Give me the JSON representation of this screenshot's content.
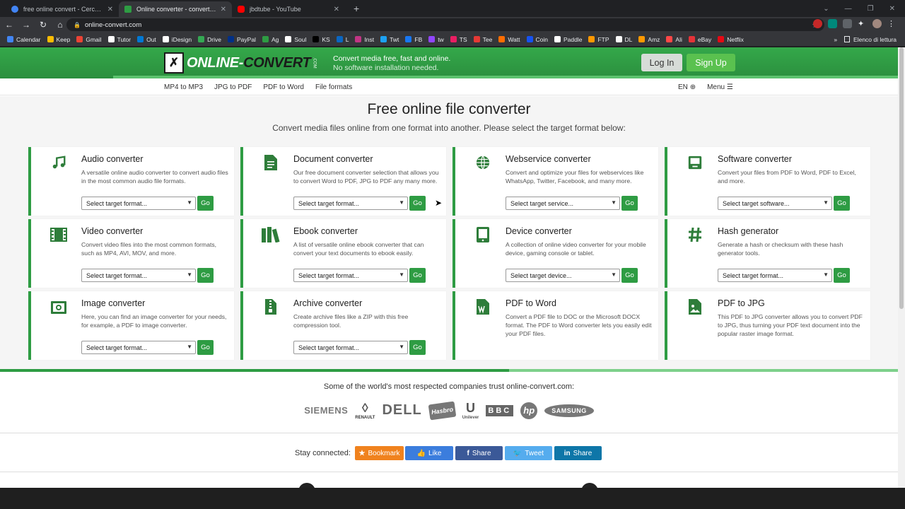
{
  "browser": {
    "tabs": [
      {
        "title": "free online convert - Cerca con G",
        "favicon_color": "#4285f4",
        "active": false
      },
      {
        "title": "Online converter - convert video",
        "favicon_color": "#2e9c43",
        "active": true
      },
      {
        "title": "jbdtube - YouTube",
        "favicon_color": "#ff0000",
        "active": false
      }
    ],
    "new_tab": "+",
    "url": "online-convert.com",
    "bookmarks": [
      "Calendar",
      "Keep",
      "Gmail",
      "Tutor",
      "Out",
      "iDesign",
      "Drive",
      "PayPal",
      "Ag",
      "Soul",
      "KS",
      "L",
      "Inst",
      "Twt",
      "FB",
      "tw",
      "TS",
      "Tee",
      "Watt",
      "Coin",
      "Paddle",
      "FTP",
      "DL",
      "Amz",
      "Ali",
      "eBay",
      "Netflix"
    ],
    "bookmark_colors": [
      "#4285f4",
      "#fbbc04",
      "#ea4335",
      "#ffffff",
      "#0078d4",
      "#ffffff",
      "#34a853",
      "#003087",
      "#2e9c43",
      "#ffffff",
      "#000000",
      "#0a66c2",
      "#c13584",
      "#1da1f2",
      "#1877f2",
      "#9146ff",
      "#e91e63",
      "#e53935",
      "#ff6d00",
      "#1652f0",
      "#ffffff",
      "#ff9800",
      "#fafafa",
      "#ff9900",
      "#ff4747",
      "#e53238",
      "#e50914"
    ],
    "more_bookmarks": "»",
    "reading_list": "Elenco di lettura"
  },
  "header": {
    "logo_text_white": "ONLINE-",
    "logo_text_dark": "CONVERT",
    "logo_com": ".COM",
    "tagline": "Convert media free, fast and online.",
    "tagline_sub": "No software installation needed.",
    "login": "Log In",
    "signup": "Sign Up"
  },
  "subnav": {
    "links": [
      "MP4 to MP3",
      "JPG to PDF",
      "PDF to Word",
      "File formats"
    ],
    "lang": "EN",
    "menu": "Menu"
  },
  "main": {
    "title": "Free online file converter",
    "subtitle": "Convert media files online from one format into another. Please select the target format below:",
    "go": "Go",
    "cards": [
      {
        "title": "Audio converter",
        "desc": "A versatile online audio converter to convert audio files in the most common audio file formats.",
        "select": "Select target format...",
        "icon": "music-note-icon"
      },
      {
        "title": "Document converter",
        "desc": "Our free document converter selection that allows you to convert Word to PDF, JPG to PDF any many more.",
        "select": "Select target format...",
        "icon": "document-icon"
      },
      {
        "title": "Webservice converter",
        "desc": "Convert and optimize your files for webservices like WhatsApp, Twitter, Facebook, and many more.",
        "select": "Select target service...",
        "icon": "globe-icon"
      },
      {
        "title": "Software converter",
        "desc": "Convert your files from PDF to Word, PDF to Excel, and more.",
        "select": "Select target software...",
        "icon": "monitor-icon"
      },
      {
        "title": "Video converter",
        "desc": "Convert video files into the most common formats, such as MP4, AVI, MOV, and more.",
        "select": "Select target format...",
        "icon": "film-icon"
      },
      {
        "title": "Ebook converter",
        "desc": "A list of versatile online ebook converter that can convert your text documents to ebook easily.",
        "select": "Select target format...",
        "icon": "books-icon"
      },
      {
        "title": "Device converter",
        "desc": "A collection of online video converter for your mobile device, gaming console or tablet.",
        "select": "Select target device...",
        "icon": "tablet-icon"
      },
      {
        "title": "Hash generator",
        "desc": "Generate a hash or checksum with these hash generator tools.",
        "select": "Select target format...",
        "icon": "hash-icon"
      },
      {
        "title": "Image converter",
        "desc": "Here, you can find an image converter for your needs, for example, a PDF to image converter.",
        "select": "Select target format...",
        "icon": "camera-icon"
      },
      {
        "title": "Archive converter",
        "desc": "Create archive files like a ZIP with this free compression tool.",
        "select": "Select target format...",
        "icon": "archive-icon"
      },
      {
        "title": "PDF to Word",
        "desc": "Convert a PDF file to DOC or the Microsoft DOCX format. The PDF to Word converter lets you easily edit your PDF files.",
        "select": "",
        "icon": "word-doc-icon"
      },
      {
        "title": "PDF to JPG",
        "desc": "This PDF to JPG converter allows you to convert PDF to JPG, thus turning your PDF text document into the popular raster image format.",
        "select": "",
        "icon": "image-doc-icon"
      }
    ]
  },
  "trust": {
    "text": "Some of the world's most respected companies trust online-convert.com:",
    "logos": [
      "SIEMENS",
      "RENAULT",
      "DELL",
      "Hasbro",
      "Unilever",
      "BBC",
      "hp",
      "SAMSUNG"
    ]
  },
  "social": {
    "label": "Stay connected:",
    "buttons": [
      {
        "label": "Bookmark",
        "glyph": "★",
        "color": "#f0821e"
      },
      {
        "label": "Like",
        "glyph": "👍",
        "color": "#3b7ddd"
      },
      {
        "label": "Share",
        "glyph": "f",
        "color": "#3b5998"
      },
      {
        "label": "Tweet",
        "glyph": "🐦",
        "color": "#55acee"
      },
      {
        "label": "Share",
        "glyph": "in",
        "color": "#0e76a8"
      }
    ]
  }
}
